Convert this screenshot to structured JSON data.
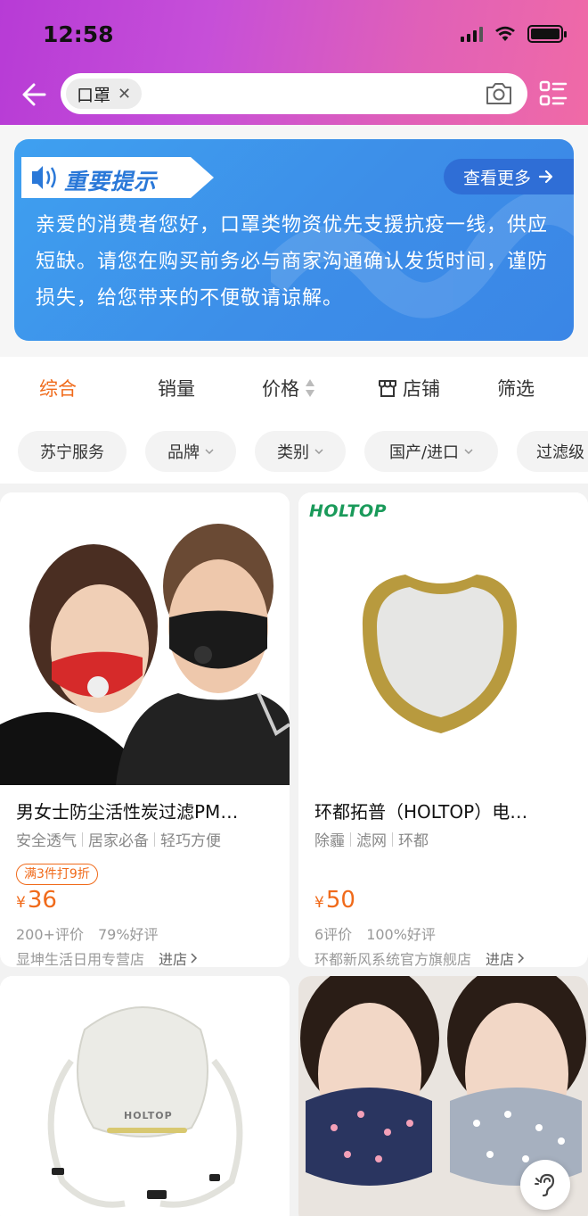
{
  "status_bar": {
    "time": "12:58"
  },
  "search": {
    "query_chip": "口罩"
  },
  "notice": {
    "tag": "重要提示",
    "more_label": "查看更多",
    "body": "亲爱的消费者您好，口罩类物资优先支援抗疫一线，供应短缺。请您在购买前务必与商家沟通确认发货时间，谨防损失，给您带来的不便敬请谅解。"
  },
  "sort_tabs": [
    {
      "label": "综合",
      "active": true
    },
    {
      "label": "销量"
    },
    {
      "label": "价格"
    },
    {
      "label": "店铺"
    },
    {
      "label": "筛选"
    }
  ],
  "filters": [
    "苏宁服务",
    "品牌",
    "类别",
    "国产/进口",
    "过滤级"
  ],
  "products": [
    {
      "title": "男女士防尘活性炭过滤PM…",
      "tags": [
        "安全透气",
        "居家必备",
        "轻巧方便"
      ],
      "promo": "满3件打9折",
      "price": "36",
      "reviews_count": "200+评价",
      "positive_rate": "79%好评",
      "shop": "显坤生活日用专营店",
      "enter_label": "进店"
    },
    {
      "brand_logo": "HOLTOP",
      "title": "环都拓普（HOLTOP）电…",
      "tags": [
        "除霾",
        "滤网",
        "环都"
      ],
      "price": "50",
      "reviews_count": "6评价",
      "positive_rate": "100%好评",
      "shop": "环都新风系统官方旗舰店",
      "enter_label": "进店"
    },
    {
      "brand_logo": "HOLTOP"
    },
    {}
  ],
  "currency_symbol": "¥",
  "colors": {
    "accent": "#f06a1a",
    "banner_blue": "#3d8ee8",
    "header_purple": "#b73bd6"
  }
}
